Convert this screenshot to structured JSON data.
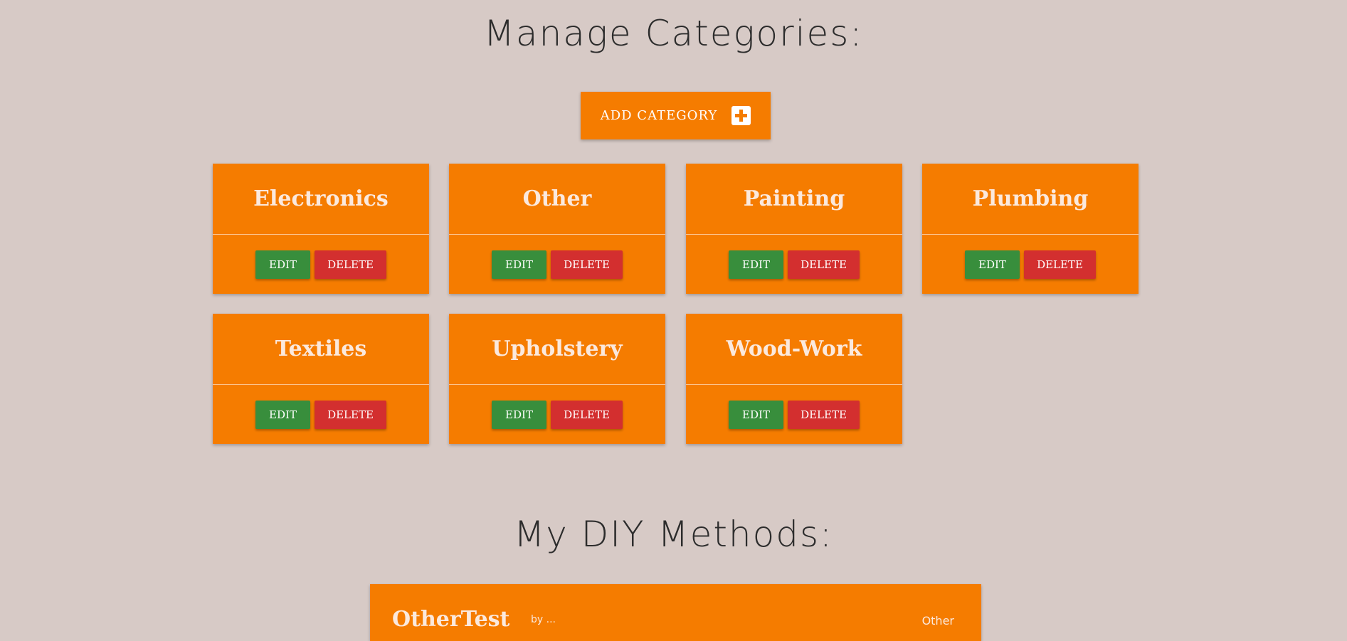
{
  "manage_title": "Manage Categories:",
  "add_button_label": "ADD CATEGORY",
  "categories": [
    {
      "name": "Electronics",
      "edit_label": "EDIT",
      "delete_label": "DELETE"
    },
    {
      "name": "Other",
      "edit_label": "EDIT",
      "delete_label": "DELETE"
    },
    {
      "name": "Painting",
      "edit_label": "EDIT",
      "delete_label": "DELETE"
    },
    {
      "name": "Plumbing",
      "edit_label": "EDIT",
      "delete_label": "DELETE"
    },
    {
      "name": "Textiles",
      "edit_label": "EDIT",
      "delete_label": "DELETE"
    },
    {
      "name": "Upholstery",
      "edit_label": "EDIT",
      "delete_label": "DELETE"
    },
    {
      "name": "Wood-Work",
      "edit_label": "EDIT",
      "delete_label": "DELETE"
    }
  ],
  "methods_title": "My DIY Methods:",
  "methods": [
    {
      "title": "OtherTest",
      "subtitle": "by ...",
      "category": "Other"
    }
  ],
  "colors": {
    "background": "#d7cac6",
    "card": "#f57c00",
    "edit": "#388e3c",
    "delete": "#d32f2f"
  },
  "icons": {
    "add": "plus-icon"
  }
}
